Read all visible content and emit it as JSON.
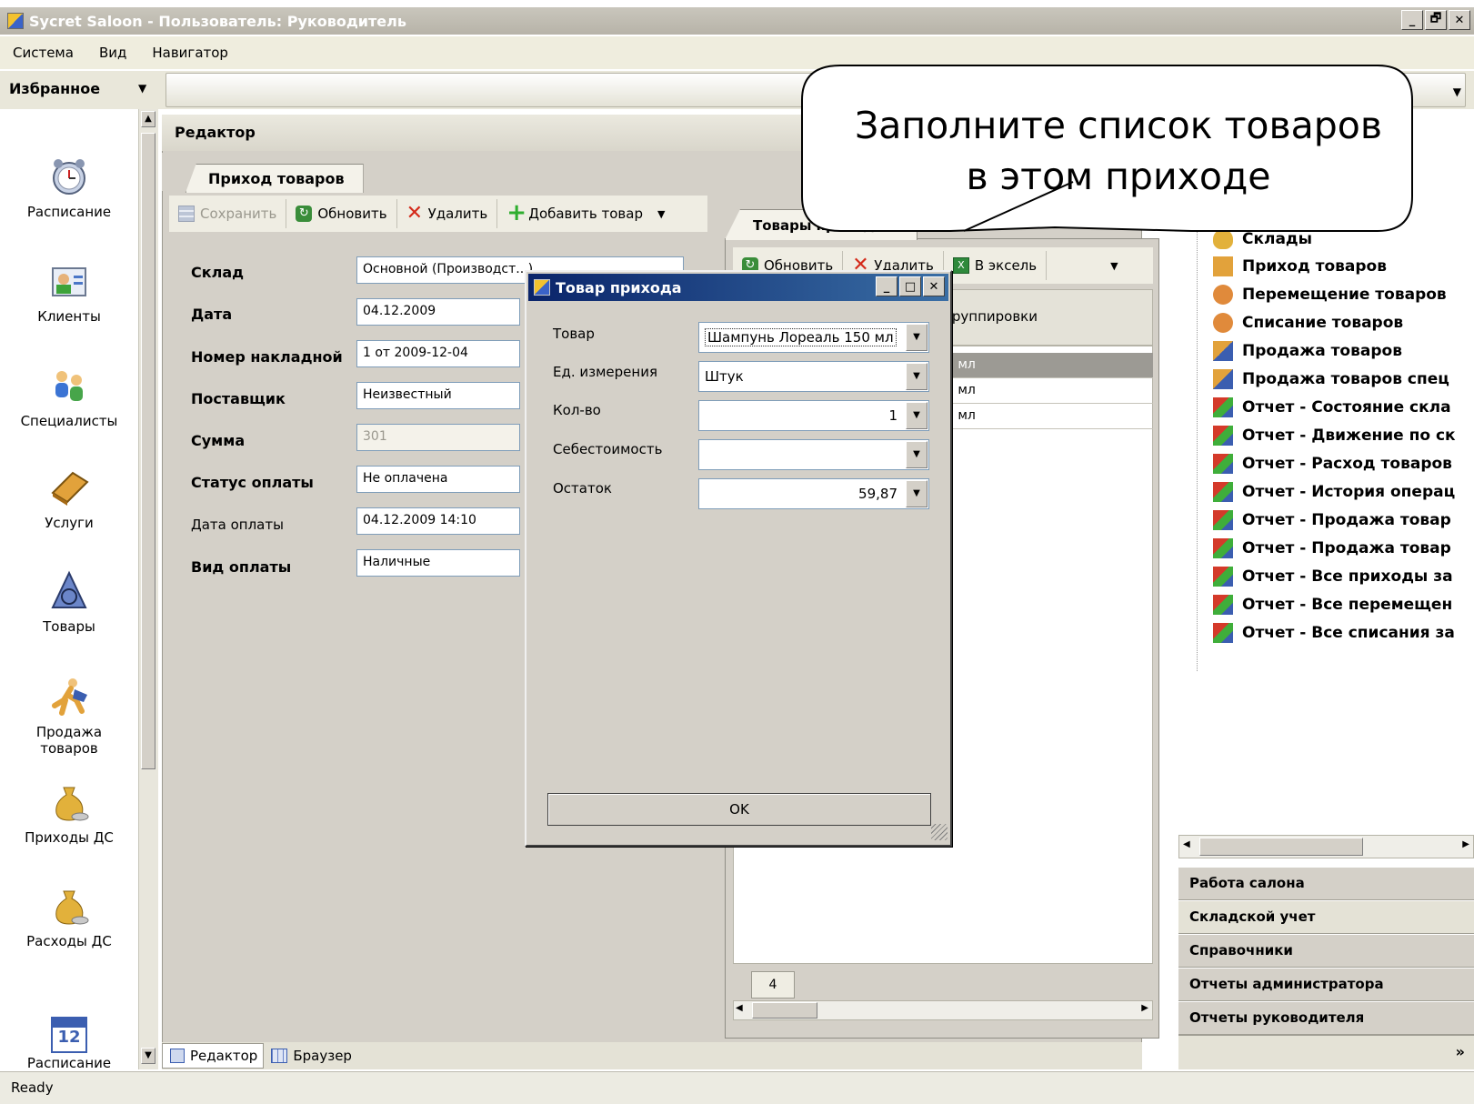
{
  "window": {
    "title": "Sycret Saloon - Пользователь: Руководитель",
    "minimize": "_",
    "restore": "🗗",
    "close": "✕"
  },
  "menu": {
    "items": [
      "Система",
      "Вид",
      "Навигатор"
    ]
  },
  "favorites": {
    "label": "Избранное"
  },
  "left_nav": {
    "items": [
      "Расписание",
      "Клиенты",
      "Специалисты",
      "Услуги",
      "Товары",
      "Продажа товаров",
      "Приходы ДС",
      "Расходы ДС",
      "Расписание"
    ],
    "calendar_day": "12"
  },
  "editor": {
    "header": "Редактор",
    "tab": "Приход товаров",
    "toolbar": {
      "save": "Сохранить",
      "refresh": "Обновить",
      "delete": "Удалить",
      "add": "Добавить товар"
    },
    "form": {
      "warehouse_label": "Склад",
      "warehouse_value": "Основной (Производст...)",
      "date_label": "Дата",
      "date_value": "04.12.2009",
      "invoice_label": "Номер накладной",
      "invoice_value": "1 от 2009-12-04",
      "supplier_label": "Поставщик",
      "supplier_value": "Неизвестный",
      "sum_label": "Сумма",
      "sum_value": "301",
      "pay_status_label": "Статус оплаты",
      "pay_status_value": "Не оплачена",
      "pay_date_label": "Дата оплаты",
      "pay_date_value": "04.12.2009 14:10",
      "pay_type_label": "Вид оплаты",
      "pay_type_value": "Наличные"
    },
    "bottom_tabs": [
      "Редактор",
      "Браузер"
    ]
  },
  "goods": {
    "tab": "Товары прихода",
    "toolbar": {
      "refresh": "Обновить",
      "delete": "Удалить",
      "excel": "В эксель"
    },
    "group_hint": "группировки",
    "rows": [
      "0 мл",
      "0 мл",
      "0 мл"
    ],
    "count": "4"
  },
  "tree": {
    "items": [
      "Склады",
      "Приход товаров",
      "Перемещение товаров",
      "Списание товаров",
      "Продажа товаров",
      "Продажа товаров спец",
      "Отчет - Состояние скла",
      "Отчет - Движение по ск",
      "Отчет - Расход товаров",
      "Отчет - История операц",
      "Отчет - Продажа товар",
      "Отчет - Продажа товар",
      "Отчет - Все приходы за",
      "Отчет - Все перемещен",
      "Отчет - Все списания за"
    ],
    "groups": [
      "Работа салона",
      "Складской учет",
      "Справочники",
      "Отчеты администратора",
      "Отчеты руководителя"
    ],
    "more": "»"
  },
  "dialog": {
    "title": "Товар прихода",
    "product_label": "Товар",
    "product_value": "Шампунь Лореаль 150 мл",
    "unit_label": "Ед. измерения",
    "unit_value": "Штук",
    "qty_label": "Кол-во",
    "qty_value": "1",
    "cost_label": "Себестоимость",
    "cost_value": "",
    "rest_label": "Остаток",
    "rest_value": "59,87",
    "ok": "OK"
  },
  "callout": {
    "line1": "Заполните список товаров",
    "line2": "в этом приходе"
  },
  "status": {
    "text": "Ready"
  },
  "colors": {
    "dialog_title": "#0a246a",
    "accent_green": "#2fae2f",
    "delete_red": "#d42a1a"
  }
}
